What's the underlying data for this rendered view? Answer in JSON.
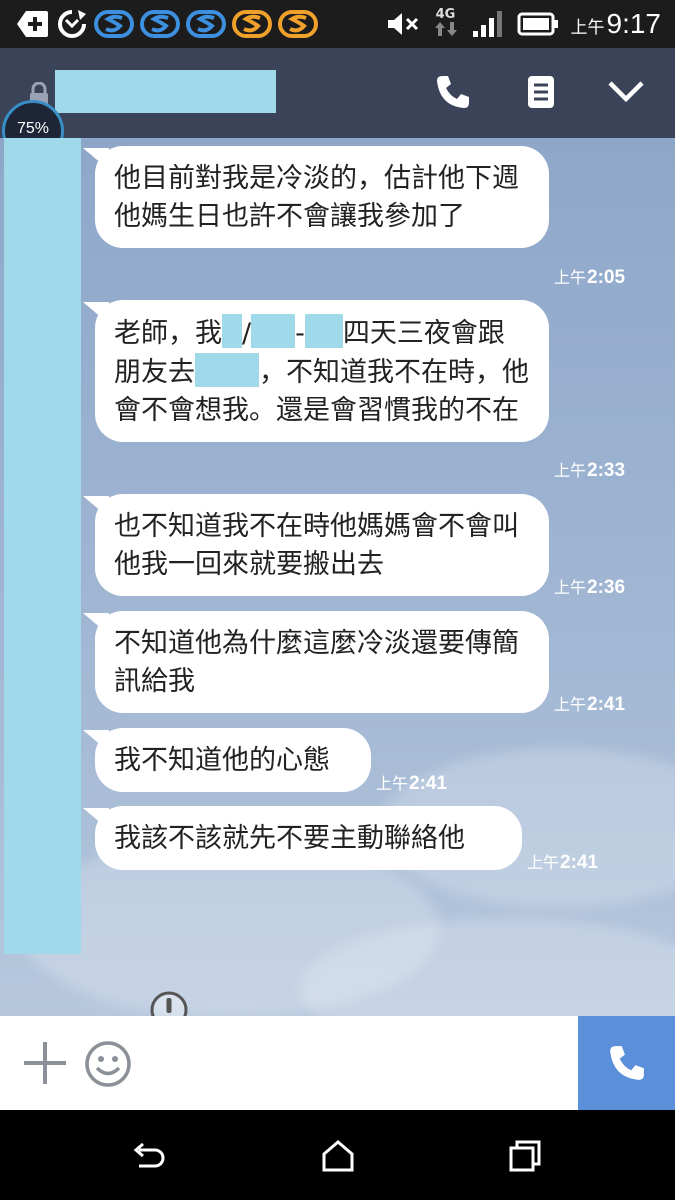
{
  "status_bar": {
    "time": "9:17",
    "ampm": "上午",
    "network": "4G",
    "icons": [
      "add-icon",
      "sync-icon",
      "app-s-icon",
      "mute-icon",
      "signal-icon",
      "battery-icon"
    ]
  },
  "header": {
    "battery_badge": "75%",
    "icons": [
      "lock-icon",
      "phone-icon",
      "notes-icon",
      "chevron-down-icon"
    ]
  },
  "messages": [
    {
      "id": "m1",
      "text": "他目前對我是冷淡的，估計他下週他媽生日也許不會讓我參加了",
      "ampm": "上午",
      "time": "2:05"
    },
    {
      "id": "m2",
      "parts": [
        "老師，我",
        "/",
        "-",
        "四天三夜會跟朋友去",
        "，不知道我不在時，他會不會想我。還是會習慣我的不在"
      ],
      "ampm": "上午",
      "time": "2:33"
    },
    {
      "id": "m3",
      "text": "也不知道我不在時他媽媽會不會叫他我一回來就要搬出去",
      "ampm": "上午",
      "time": "2:36"
    },
    {
      "id": "m4",
      "text": "不知道他為什麼這麼冷淡還要傳簡訊給我",
      "ampm": "上午",
      "time": "2:41"
    },
    {
      "id": "m5",
      "text": "我不知道他的心態",
      "ampm": "上午",
      "time": "2:41"
    },
    {
      "id": "m6",
      "text": "我該不該就先不要主動聯絡他",
      "ampm": "上午",
      "time": "2:41"
    }
  ],
  "input_bar": {
    "icons": [
      "plus-icon",
      "emoji-icon",
      "call-icon"
    ]
  },
  "nav_bar": {
    "icons": [
      "back-icon",
      "home-icon",
      "recents-icon"
    ]
  },
  "colors": {
    "header_bg": "#3a4358",
    "status_bg": "#1c1c1c",
    "redaction": "#9fd9ea",
    "call_button": "#5b8fd9",
    "chat_bg": "#9db3d1"
  }
}
